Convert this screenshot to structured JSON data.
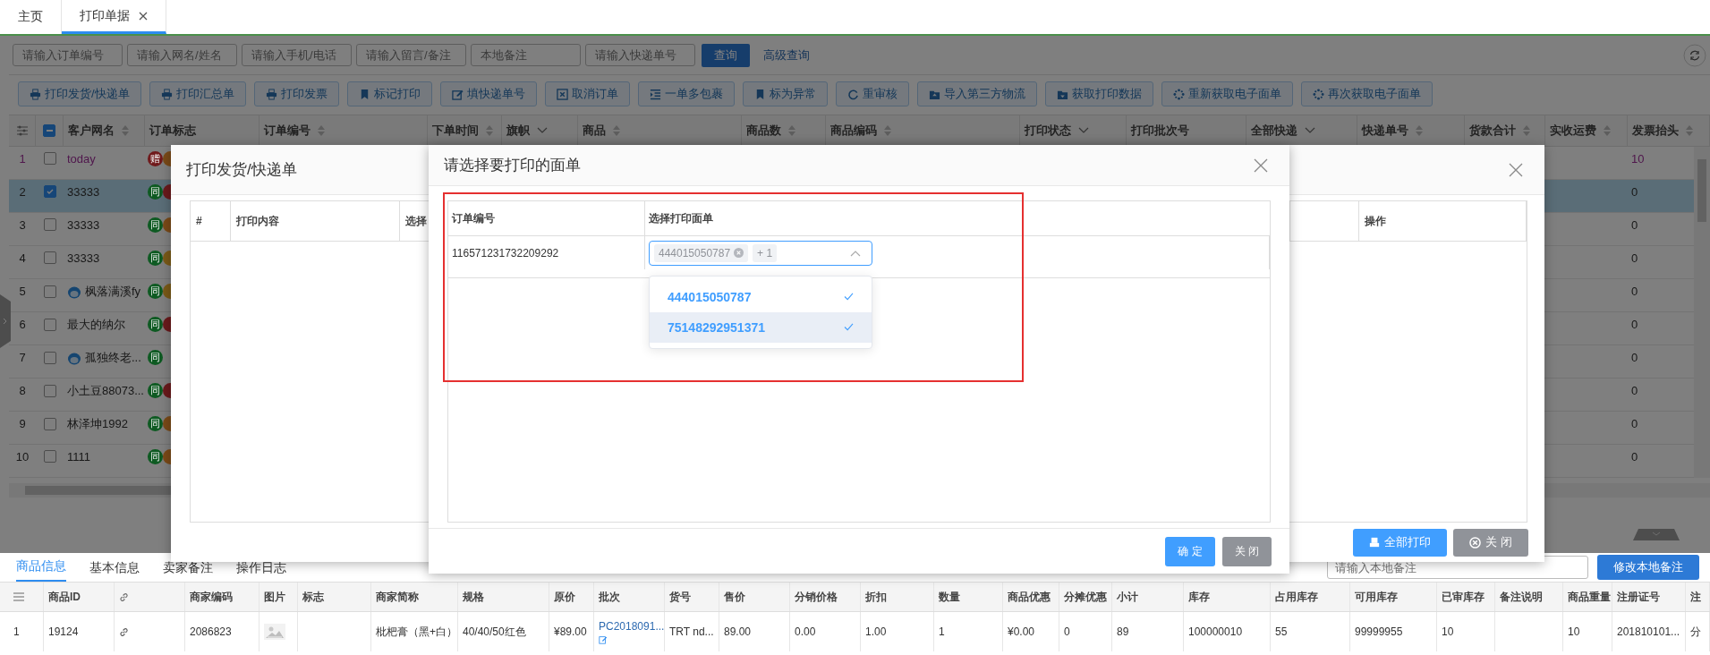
{
  "tabs": [
    {
      "label": "主页",
      "selected": false,
      "closable": false
    },
    {
      "label": "打印单据",
      "selected": true,
      "closable": true
    }
  ],
  "search": {
    "fields": [
      {
        "placeholder": "请输入订单编号"
      },
      {
        "placeholder": "请输入网名/姓名"
      },
      {
        "placeholder": "请输入手机/电话"
      },
      {
        "placeholder": "请输入留言/备注"
      },
      {
        "placeholder": "本地备注"
      },
      {
        "placeholder": "请输入快递单号"
      }
    ],
    "button": "查询",
    "link": "高级查询"
  },
  "toolbar": [
    {
      "label": "打印发货/快递单",
      "kind": "printer"
    },
    {
      "label": "打印汇总单",
      "kind": "printer"
    },
    {
      "label": "打印发票",
      "kind": "printer"
    },
    {
      "label": "标记打印",
      "kind": "bookmark"
    },
    {
      "label": "填快递单号",
      "kind": "edit"
    },
    {
      "label": "取消订单",
      "kind": "cancel"
    },
    {
      "label": "一单多包裹",
      "kind": "indent"
    },
    {
      "label": "标为异常",
      "kind": "bookmark"
    },
    {
      "label": "重审核",
      "kind": "refresh"
    },
    {
      "label": "导入第三方物流",
      "kind": "folder-up"
    },
    {
      "label": "获取打印数据",
      "kind": "folder-down"
    },
    {
      "label": "重新获取电子面单",
      "kind": "spinner"
    },
    {
      "label": "再次获取电子面单",
      "kind": "spinner"
    }
  ],
  "orders": {
    "select_all_indeterminate": true,
    "columns": [
      {
        "label": "客户网名",
        "kind": "sort"
      },
      {
        "label": "订单标志",
        "kind": "plain"
      },
      {
        "label": "订单编号",
        "kind": "sort"
      },
      {
        "label": "下单时间",
        "kind": "sort"
      },
      {
        "label": "旗帜",
        "kind": "filter"
      },
      {
        "label": "商品",
        "kind": "sort"
      },
      {
        "label": "商品数",
        "kind": "sort"
      },
      {
        "label": "商品编码",
        "kind": "sort"
      },
      {
        "label": "打印状态",
        "kind": "filter"
      },
      {
        "label": "打印批次号",
        "kind": "plain"
      },
      {
        "label": "全部快递",
        "kind": "filter"
      },
      {
        "label": "快递单号",
        "kind": "sort"
      },
      {
        "label": "货款合计",
        "kind": "sort"
      },
      {
        "label": "实收运费",
        "kind": "sort"
      },
      {
        "label": "发票抬头",
        "kind": "sort"
      }
    ],
    "rows": [
      {
        "index": "1",
        "checked": false,
        "selected": false,
        "highlighted": true,
        "name": "today",
        "avatar": false,
        "flags": [
          {
            "text": "赠",
            "color": "#701a1c"
          },
          {
            "color": "#7a4a18"
          }
        ],
        "freight": "10"
      },
      {
        "index": "2",
        "checked": true,
        "selected": true,
        "highlighted": false,
        "name": "33333",
        "avatar": false,
        "flags": [
          {
            "text": "同",
            "color": "#0e5a22"
          },
          {
            "color": "#6a1a1c"
          }
        ],
        "freight": "0"
      },
      {
        "index": "3",
        "checked": false,
        "selected": false,
        "highlighted": false,
        "name": "33333",
        "avatar": false,
        "flags": [
          {
            "text": "同",
            "color": "#0e5a22"
          },
          {
            "color": "#7a4a18"
          }
        ],
        "freight": "0"
      },
      {
        "index": "4",
        "checked": false,
        "selected": false,
        "highlighted": false,
        "name": "33333",
        "avatar": false,
        "flags": [
          {
            "text": "同",
            "color": "#0e5a22"
          },
          {
            "color": "#7a5a18"
          }
        ],
        "freight": "0"
      },
      {
        "index": "5",
        "checked": false,
        "selected": false,
        "highlighted": false,
        "name": "枫落满溪fy",
        "avatar": true,
        "flags": [
          {
            "text": "同",
            "color": "#0e5a22"
          },
          {
            "color": "#7a5a18"
          }
        ],
        "freight": "0"
      },
      {
        "index": "6",
        "checked": false,
        "selected": false,
        "highlighted": false,
        "name": "最大的纳尔",
        "avatar": false,
        "flags": [
          {
            "text": "同",
            "color": "#0e5a22"
          },
          {
            "color": "#6a1a1c"
          }
        ],
        "freight": "0"
      },
      {
        "index": "7",
        "checked": false,
        "selected": false,
        "highlighted": false,
        "name": "孤独终老...",
        "avatar": true,
        "flags": [
          {
            "text": "同",
            "color": "#0e5a22"
          }
        ],
        "freight": "0"
      },
      {
        "index": "8",
        "checked": false,
        "selected": false,
        "highlighted": false,
        "name": "小土豆88073...",
        "avatar": false,
        "flags": [
          {
            "text": "同",
            "color": "#0e5a22"
          },
          {
            "color": "#6a1a1c"
          }
        ],
        "freight": "0"
      },
      {
        "index": "9",
        "checked": false,
        "selected": false,
        "highlighted": false,
        "name": "林泽坤1992",
        "avatar": false,
        "flags": [
          {
            "text": "同",
            "color": "#0e5a22"
          },
          {
            "color": "#7a4a18"
          }
        ],
        "freight": "0"
      },
      {
        "index": "10",
        "checked": false,
        "selected": false,
        "highlighted": false,
        "name": "1111",
        "avatar": false,
        "flags": [
          {
            "text": "同",
            "color": "#0e5a22"
          },
          {
            "color": "#7a4a18"
          }
        ],
        "freight": "0"
      }
    ]
  },
  "print_dialog": {
    "title": "打印发货/快递单",
    "columns": [
      "#",
      "打印内容",
      "选择",
      "操作"
    ],
    "buttons": [
      {
        "label": "全部打印",
        "kind": "primary"
      },
      {
        "label": "关 闭",
        "kind": "secondary"
      }
    ]
  },
  "waybill_dialog": {
    "title": "请选择要打印的面单",
    "columns": [
      "订单编号",
      "选择打印面单"
    ],
    "order_no": "116571231732209292",
    "tags": [
      {
        "text": "444015050787",
        "closable": true
      },
      {
        "text": "+ 1",
        "closable": false
      }
    ],
    "open": true,
    "options": [
      {
        "text": "444015050787",
        "selected": true,
        "hovered": false
      },
      {
        "text": "75148292951371",
        "selected": true,
        "hovered": true
      }
    ],
    "buttons": [
      {
        "label": "确 定",
        "kind": "primary"
      },
      {
        "label": "关 闭",
        "kind": "secondary"
      }
    ]
  },
  "detail": {
    "tabs": [
      {
        "label": "商品信息",
        "selected": true
      },
      {
        "label": "基本信息",
        "selected": false
      },
      {
        "label": "卖家备注",
        "selected": false
      },
      {
        "label": "操作日志",
        "selected": false
      }
    ],
    "note": {
      "placeholder": "请输入本地备注"
    },
    "note_button": "修改本地备注",
    "columns": [
      {
        "kind": "menu"
      },
      {
        "kind": "text",
        "label": "商品ID"
      },
      {
        "kind": "link"
      },
      {
        "kind": "text",
        "label": "商家编码"
      },
      {
        "kind": "text",
        "label": "图片"
      },
      {
        "kind": "text",
        "label": "标志"
      },
      {
        "kind": "text",
        "label": "商家简称"
      },
      {
        "kind": "text",
        "label": "规格"
      },
      {
        "kind": "text",
        "label": "原价"
      },
      {
        "kind": "text",
        "label": "批次"
      },
      {
        "kind": "text",
        "label": "货号"
      },
      {
        "kind": "text",
        "label": "售价"
      },
      {
        "kind": "text",
        "label": "分销价格"
      },
      {
        "kind": "text",
        "label": "折扣"
      },
      {
        "kind": "text",
        "label": "数量"
      },
      {
        "kind": "text",
        "label": "商品优惠"
      },
      {
        "kind": "text",
        "label": "分摊优惠"
      },
      {
        "kind": "text",
        "label": "小计"
      },
      {
        "kind": "text",
        "label": "库存"
      },
      {
        "kind": "text",
        "label": "占用库存"
      },
      {
        "kind": "text",
        "label": "可用库存"
      },
      {
        "kind": "text",
        "label": "已审库存"
      },
      {
        "kind": "text",
        "label": "备注说明"
      },
      {
        "kind": "text",
        "label": "商品重量"
      },
      {
        "kind": "text",
        "label": "注册证号"
      },
      {
        "kind": "text",
        "label": "注"
      }
    ],
    "rows": [
      {
        "cells": [
          {
            "kind": "text",
            "text": "1"
          },
          {
            "kind": "text",
            "text": "19124"
          },
          {
            "kind": "link"
          },
          {
            "kind": "text",
            "text": "2086823"
          },
          {
            "kind": "picture"
          },
          {
            "kind": "empty"
          },
          {
            "kind": "text",
            "text": "枇杷膏（黑+白）"
          },
          {
            "kind": "text",
            "text": "40/40/50红色"
          },
          {
            "kind": "text",
            "text": "¥89.00"
          },
          {
            "kind": "batch",
            "text": "PC2018091..."
          },
          {
            "kind": "text",
            "text": "TRT nd..."
          },
          {
            "kind": "text",
            "text": "89.00"
          },
          {
            "kind": "text",
            "text": "0.00"
          },
          {
            "kind": "text",
            "text": "1.00"
          },
          {
            "kind": "text",
            "text": "1"
          },
          {
            "kind": "text",
            "text": "¥0.00"
          },
          {
            "kind": "text",
            "text": "0"
          },
          {
            "kind": "text",
            "text": "89"
          },
          {
            "kind": "text",
            "text": "100000010"
          },
          {
            "kind": "text",
            "text": "55"
          },
          {
            "kind": "text",
            "text": "99999955"
          },
          {
            "kind": "text",
            "text": "10"
          },
          {
            "kind": "empty"
          },
          {
            "kind": "text",
            "text": "10"
          },
          {
            "kind": "text",
            "text": "201810101..."
          },
          {
            "kind": "text",
            "text": "分"
          }
        ]
      }
    ]
  }
}
